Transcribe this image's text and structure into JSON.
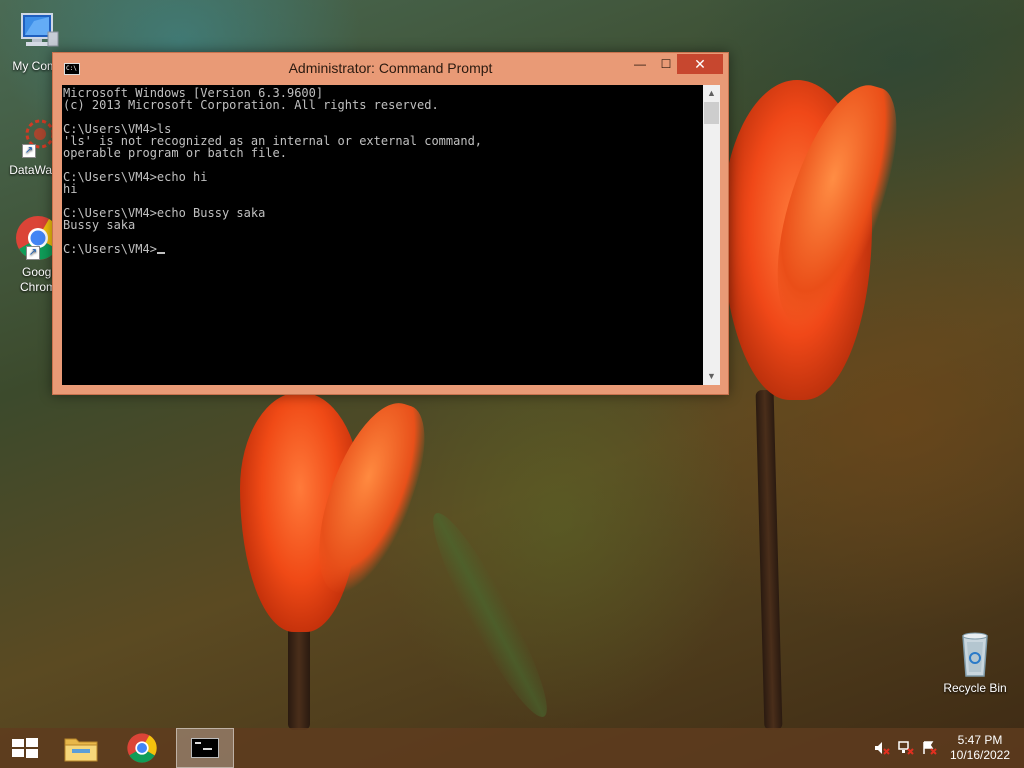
{
  "desktop": {
    "icons": [
      {
        "label": "My Comp",
        "icon": "computer-icon"
      },
      {
        "label": "DataWag",
        "icon": "datawag-icon"
      },
      {
        "label": "Googl",
        "label2": "Chrom",
        "icon": "chrome-icon"
      },
      {
        "label": "Recycle Bin",
        "icon": "recycle-bin-icon"
      }
    ]
  },
  "window": {
    "title": "Administrator: Command Prompt",
    "icon_text": "C:\\",
    "minimize_glyph": "—",
    "maximize_glyph": "☐",
    "close_glyph": "✕",
    "console_lines": [
      "Microsoft Windows [Version 6.3.9600]",
      "(c) 2013 Microsoft Corporation. All rights reserved.",
      "",
      "C:\\Users\\VM4>ls",
      "'ls' is not recognized as an internal or external command,",
      "operable program or batch file.",
      "",
      "C:\\Users\\VM4>echo hi",
      "hi",
      "",
      "C:\\Users\\VM4>echo Bussy saka",
      "Bussy saka",
      "",
      "C:\\Users\\VM4>"
    ],
    "scroll_up_glyph": "▲",
    "scroll_down_glyph": "▼"
  },
  "taskbar": {
    "items": [
      "start-button",
      "file-explorer",
      "google-chrome",
      "command-prompt"
    ],
    "tray_icons": [
      "speaker-muted-icon",
      "network-icon",
      "action-center-flag-icon"
    ],
    "time": "5:47 PM",
    "date": "10/16/2022"
  }
}
